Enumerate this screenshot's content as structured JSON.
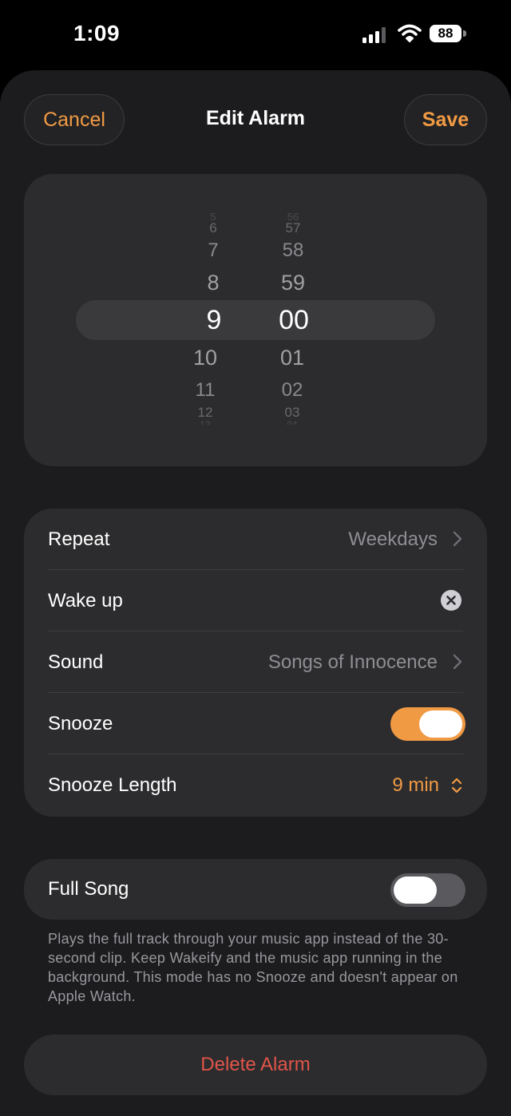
{
  "status": {
    "time": "1:09",
    "battery": "88"
  },
  "nav": {
    "cancel": "Cancel",
    "title": "Edit Alarm",
    "save": "Save"
  },
  "picker": {
    "hours": [
      "5",
      "6",
      "7",
      "8",
      "9",
      "10",
      "11",
      "12",
      "13"
    ],
    "minutes": [
      "56",
      "57",
      "58",
      "59",
      "00",
      "01",
      "02",
      "03",
      "04"
    ],
    "selected_hour": "9",
    "selected_minute": "00"
  },
  "settings": {
    "repeat_label": "Repeat",
    "repeat_value": "Weekdays",
    "label_value": "Wake up",
    "sound_label": "Sound",
    "sound_value": "Songs of Innocence",
    "snooze_label": "Snooze",
    "snooze_on": true,
    "snooze_length_label": "Snooze Length",
    "snooze_length_value": "9 min"
  },
  "full_song": {
    "label": "Full Song",
    "on": false,
    "footnote": "Plays the full track through your music app instead of the 30-second clip. Keep Wakeify and the music app running in the background. This mode has no Snooze and doesn't appear on Apple Watch."
  },
  "delete_label": "Delete Alarm",
  "colors": {
    "accent": "#f09a44",
    "destructive": "#e0554a",
    "card": "#2c2c2e",
    "sheet": "#1c1c1e"
  }
}
